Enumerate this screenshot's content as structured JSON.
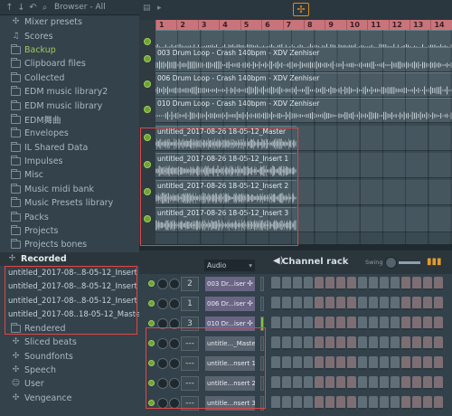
{
  "browser": {
    "toolbar_title": "Browser - All",
    "items": [
      {
        "label": "Mixer presets",
        "icon": "glyph-icon"
      },
      {
        "label": "Scores",
        "icon": "note-icon"
      },
      {
        "label": "Backup",
        "icon": "folder-icon"
      },
      {
        "label": "Clipboard files",
        "icon": "folder-icon"
      },
      {
        "label": "Collected",
        "icon": "folder-icon"
      },
      {
        "label": "EDM music library2",
        "icon": "folder-icon"
      },
      {
        "label": "EDM music library",
        "icon": "folder-icon"
      },
      {
        "label": "EDM舞曲",
        "icon": "folder-icon"
      },
      {
        "label": "Envelopes",
        "icon": "folder-icon"
      },
      {
        "label": "IL Shared Data",
        "icon": "folder-icon"
      },
      {
        "label": "Impulses",
        "icon": "folder-icon"
      },
      {
        "label": "Misc",
        "icon": "folder-icon"
      },
      {
        "label": "Music midi bank",
        "icon": "folder-icon"
      },
      {
        "label": "Music Presets library",
        "icon": "folder-icon"
      },
      {
        "label": "Packs",
        "icon": "folder-icon"
      },
      {
        "label": "Projects",
        "icon": "folder-icon"
      },
      {
        "label": "Projects bones",
        "icon": "folder-icon"
      }
    ],
    "recorded": {
      "label": "Recorded",
      "files": [
        "untitled_2017-08-..8-05-12_Insert 1",
        "untitled_2017-08-..8-05-12_Insert 2",
        "untitled_2017-08-..8-05-12_Insert 3",
        "untitled_2017-08..18-05-12_Master"
      ]
    },
    "items_after": [
      {
        "label": "Rendered",
        "icon": "folder-icon"
      },
      {
        "label": "Sliced beats",
        "icon": "glyph-icon"
      },
      {
        "label": "Soundfonts",
        "icon": "glyph-icon"
      },
      {
        "label": "Speech",
        "icon": "glyph-icon"
      },
      {
        "label": "User",
        "icon": "user-icon"
      },
      {
        "label": "Vengeance",
        "icon": "glyph-icon"
      }
    ]
  },
  "playlist": {
    "ruler_numbers": [
      "1",
      "2",
      "3",
      "4",
      "5",
      "6",
      "7",
      "8",
      "9",
      "10",
      "11",
      "12",
      "13",
      "14"
    ],
    "top_clips": [
      {
        "label": "003 Drum Loop - Crash 140bpm - XDV Zenhiser"
      },
      {
        "label": "006 Drum Loop - Crash 140bpm - XDV Zenhiser"
      },
      {
        "label": "010 Drum Loop - Crash 140bpm - XDV Zenhiser"
      }
    ],
    "recorded_clips": [
      {
        "label": "untitled_2017-08-26 18-05-12_Master"
      },
      {
        "label": "untitled_2017-08-26 18-05-12_Insert 1"
      },
      {
        "label": "untitled_2017-08-26 18-05-12_Insert 2"
      },
      {
        "label": "untitled_2017-08-26 18-05-12_Insert 3"
      }
    ]
  },
  "channel_rack": {
    "title": "Channel rack",
    "swing_label": "Swing",
    "filter_value": "Audio",
    "rows": [
      {
        "number": "2",
        "name": "003 Dr...iser"
      },
      {
        "number": "1",
        "name": "006 Dr...iser"
      },
      {
        "number": "3",
        "name": "010 Dr...iser"
      },
      {
        "number": "---",
        "name": "untitle..._Master"
      },
      {
        "number": "---",
        "name": "untitle...nsert 1"
      },
      {
        "number": "---",
        "name": "untitle...nsert 2"
      },
      {
        "number": "---",
        "name": "untitle...nsert 3"
      }
    ]
  },
  "colors": {
    "accent_orange": "#dd8b24",
    "highlight_red": "#e04646",
    "led_green": "#6fa336",
    "ruler_pink": "#c9747b"
  }
}
